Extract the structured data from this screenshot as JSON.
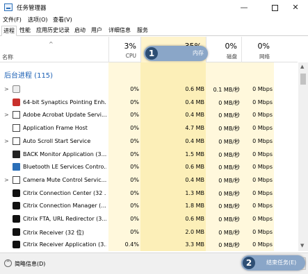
{
  "window": {
    "title": "任务管理器",
    "min_glyph": "—",
    "close_glyph": "✕"
  },
  "menu": {
    "file": "文件(F)",
    "options": "选项(O)",
    "view": "查看(V)"
  },
  "tabs": [
    "进程",
    "性能",
    "应用历史记录",
    "启动",
    "用户",
    "详细信息",
    "服务"
  ],
  "header": {
    "name_label": "名称",
    "sort_glyph": "^",
    "cpu": {
      "pct": "3%",
      "label": "CPU"
    },
    "memory": {
      "pct": "35%",
      "label": "内存"
    },
    "disk": {
      "pct": "0%",
      "label": "磁盘"
    },
    "network": {
      "pct": "0%",
      "label": "网络"
    }
  },
  "group": {
    "title": "后台进程 (115)"
  },
  "rows": [
    {
      "name": "",
      "icon": "gear-icon",
      "expandable": true,
      "cpu": "0%",
      "memory": "0.6 MB",
      "disk": "0.1 MB/秒",
      "network": "0 Mbps"
    },
    {
      "name": "64-bit Synaptics Pointing Enh...",
      "icon": "synaptics-icon",
      "expandable": false,
      "cpu": "0%",
      "memory": "0.4 MB",
      "disk": "0 MB/秒",
      "network": "0 Mbps"
    },
    {
      "name": "Adobe Acrobat Update Servi...",
      "icon": "window-icon",
      "expandable": true,
      "cpu": "0%",
      "memory": "0.4 MB",
      "disk": "0 MB/秒",
      "network": "0 Mbps"
    },
    {
      "name": "Application Frame Host",
      "icon": "window-icon",
      "expandable": false,
      "cpu": "0%",
      "memory": "4.7 MB",
      "disk": "0 MB/秒",
      "network": "0 Mbps"
    },
    {
      "name": "Auto Scroll Start Service",
      "icon": "window-icon",
      "expandable": true,
      "cpu": "0%",
      "memory": "0.4 MB",
      "disk": "0 MB/秒",
      "network": "0 Mbps"
    },
    {
      "name": "BACK Monitor Application (3...",
      "icon": "app-icon",
      "expandable": false,
      "cpu": "0%",
      "memory": "1.5 MB",
      "disk": "0 MB/秒",
      "network": "0 Mbps"
    },
    {
      "name": "Bluetooth LE Services Contro...",
      "icon": "bluetooth-icon",
      "expandable": false,
      "cpu": "0%",
      "memory": "0.6 MB",
      "disk": "0 MB/秒",
      "network": "0 Mbps"
    },
    {
      "name": "Camera Mute Control Servic...",
      "icon": "window-icon",
      "expandable": true,
      "cpu": "0%",
      "memory": "0.4 MB",
      "disk": "0 MB/秒",
      "network": "0 Mbps"
    },
    {
      "name": "Citrix Connection Center (32 ...",
      "icon": "citrix-icon",
      "expandable": false,
      "cpu": "0%",
      "memory": "1.3 MB",
      "disk": "0 MB/秒",
      "network": "0 Mbps"
    },
    {
      "name": "Citrix Connection Manager (...",
      "icon": "citrix-icon",
      "expandable": false,
      "cpu": "0%",
      "memory": "1.8 MB",
      "disk": "0 MB/秒",
      "network": "0 Mbps"
    },
    {
      "name": "Citrix FTA, URL Redirector (3...",
      "icon": "citrix-icon",
      "expandable": false,
      "cpu": "0%",
      "memory": "0.6 MB",
      "disk": "0 MB/秒",
      "network": "0 Mbps"
    },
    {
      "name": "Citrix Receiver (32 位)",
      "icon": "citrix-icon",
      "expandable": false,
      "cpu": "0%",
      "memory": "2.0 MB",
      "disk": "0 MB/秒",
      "network": "0 Mbps"
    },
    {
      "name": "Citrix Receiver Application (3...",
      "icon": "citrix-icon",
      "expandable": false,
      "cpu": "0.4%",
      "memory": "3.3 MB",
      "disk": "0 MB/秒",
      "network": "0 Mbps"
    }
  ],
  "footer": {
    "fewer_details": "简略信息(D)",
    "end_task": "结束任务(E)"
  },
  "markers": {
    "one": "1",
    "two": "2"
  },
  "colors": {
    "heat_light": "#fff4cc",
    "heat_mid": "#ffeaa0",
    "heat_row": "#f9e090",
    "group_title": "#1a5fb4",
    "marker": "#8aa6c8"
  }
}
